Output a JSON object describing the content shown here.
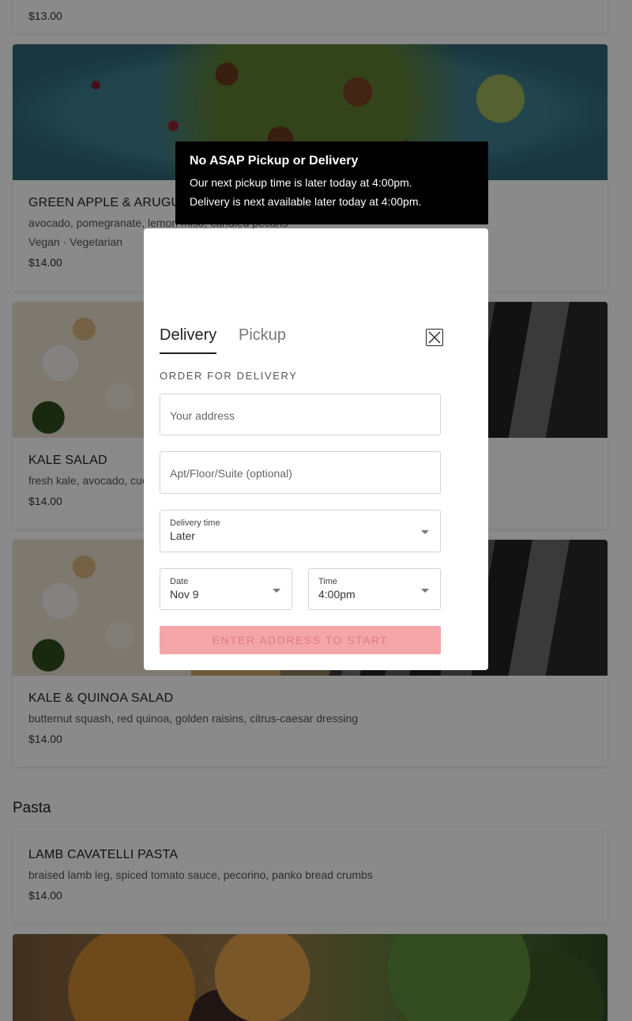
{
  "menu": {
    "prev_item_price": "$13.00",
    "items": [
      {
        "name": "GREEN APPLE & ARUGULA",
        "desc": "avocado, pomegranate, lemon miso, candied pecans",
        "tags": "Vegan · Vegetarian",
        "price": "$14.00"
      },
      {
        "name": "KALE SALAD",
        "desc": "fresh kale, avocado, cucumber",
        "price": "$14.00"
      },
      {
        "name": "KALE & QUINOA SALAD",
        "desc": "butternut squash, red quinoa, golden raisins, citrus-caesar dressing",
        "price": "$14.00"
      }
    ],
    "section_pasta": "Pasta",
    "pasta_items": [
      {
        "name": "LAMB CAVATELLI PASTA",
        "desc": "braised lamb leg, spiced tomato sauce, pecorino, panko bread crumbs",
        "price": "$14.00"
      }
    ]
  },
  "toast": {
    "title": "No ASAP Pickup or Delivery",
    "line1": "Our next pickup time is later today at 4:00pm.",
    "line2": "Delivery is next available later today at 4:00pm."
  },
  "modal": {
    "tabs": [
      "Delivery",
      "Pickup"
    ],
    "active_tab": "Delivery",
    "order_label": "ORDER FOR DELIVERY",
    "address_placeholder": "Your address",
    "apt_placeholder": "Apt/Floor/Suite (optional)",
    "delivery_time_label": "Delivery time",
    "delivery_time_value": "Later",
    "date_label": "Date",
    "date_value": "Nov 9",
    "time_label": "Time",
    "time_value": "4:00pm",
    "start_button": "ENTER ADDRESS TO START",
    "close_icon": "close-icon"
  },
  "colors": {
    "overlay": "#000000",
    "start_button_bg": "#f4a5a8",
    "start_button_text": "#e17d80"
  }
}
